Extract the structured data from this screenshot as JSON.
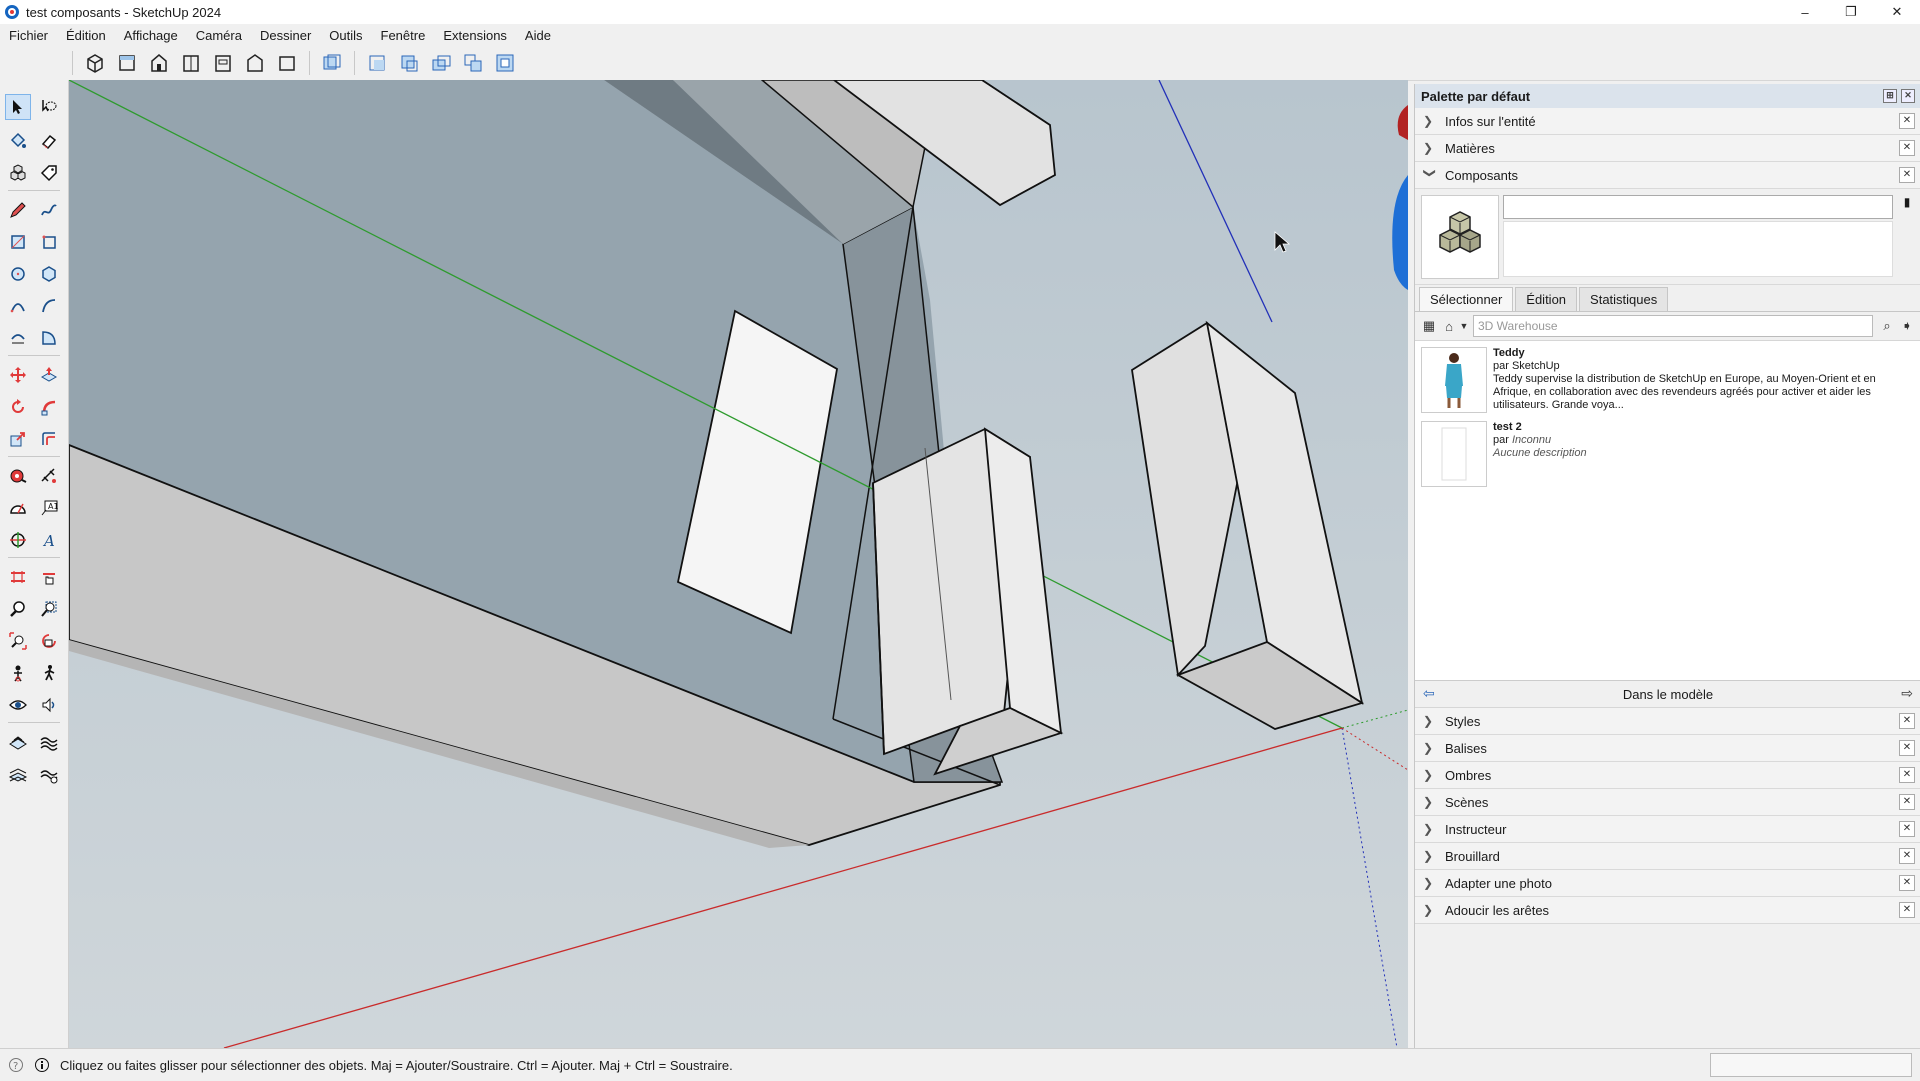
{
  "window": {
    "title": "test composants - SketchUp 2024",
    "min": "–",
    "max": "❐",
    "close": "✕"
  },
  "menu": [
    "Fichier",
    "Édition",
    "Affichage",
    "Caméra",
    "Dessiner",
    "Outils",
    "Fenêtre",
    "Extensions",
    "Aide"
  ],
  "panel": {
    "title": "Palette par défaut",
    "trays_top": [
      {
        "label": "Infos sur l'entité",
        "expanded": false
      },
      {
        "label": "Matières",
        "expanded": false
      },
      {
        "label": "Composants",
        "expanded": true
      }
    ],
    "tabs": [
      "Sélectionner",
      "Édition",
      "Statistiques"
    ],
    "active_tab": "Sélectionner",
    "search_placeholder": "3D Warehouse",
    "items": [
      {
        "name": "Teddy",
        "author": "par SketchUp",
        "description": "Teddy supervise la distribution de SketchUp en Europe, au Moyen-Orient et en Afrique, en collaboration avec des revendeurs agréés pour activer et aider les utilisateurs. Grande voya..."
      },
      {
        "name": "test 2",
        "author_prefix": "par",
        "author": "Inconnu",
        "description": "Aucune description"
      }
    ],
    "collection_label": "Dans le modèle",
    "trays_bottom": [
      "Styles",
      "Balises",
      "Ombres",
      "Scènes",
      "Instructeur",
      "Brouillard",
      "Adapter une photo",
      "Adoucir les arêtes"
    ]
  },
  "status": {
    "text": "Cliquez ou faites glisser pour sélectionner des objets. Maj = Ajouter/Soustraire. Ctrl = Ajouter. Maj + Ctrl = Soustraire."
  },
  "icons": {
    "app": "sketchup-logo-icon",
    "cursor": "mouse-pointer-icon"
  }
}
